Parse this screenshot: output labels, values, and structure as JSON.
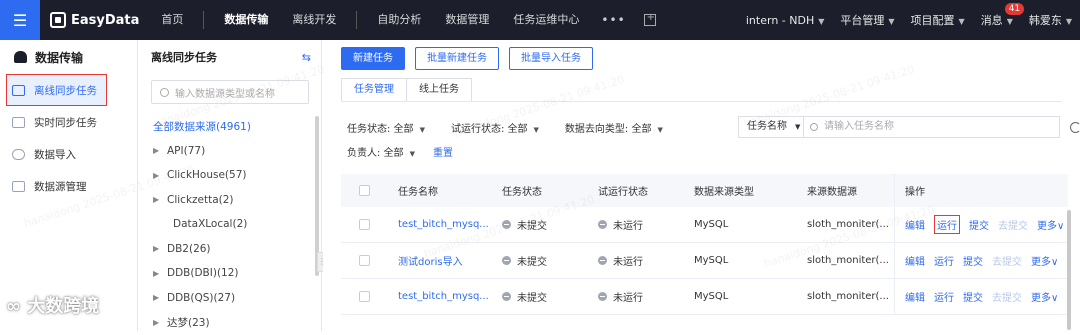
{
  "topbar": {
    "logo_text": "EasyData",
    "nav": [
      "首页",
      "数据传输",
      "离线开发",
      "自助分析",
      "数据管理",
      "任务运维中心"
    ],
    "more": "•••",
    "workspace": "intern - NDH",
    "platform": "平台管理",
    "project": "项目配置",
    "messages": "消息",
    "message_count": "41",
    "user": "韩爱东"
  },
  "sidebar": {
    "title": "数据传输",
    "items": [
      {
        "label": "离线同步任务",
        "active": true
      },
      {
        "label": "实时同步任务"
      },
      {
        "label": "数据导入"
      },
      {
        "label": "数据源管理"
      }
    ]
  },
  "tree": {
    "title": "离线同步任务",
    "collapse_icon": "⇆",
    "search_placeholder": "输入数据源类型或名称",
    "root": "全部数据来源(4961)",
    "items": [
      {
        "label": "API(77)",
        "arrow": true
      },
      {
        "label": "ClickHouse(57)",
        "arrow": true
      },
      {
        "label": "Clickzetta(2)",
        "arrow": true
      },
      {
        "label": "DataXLocal(2)",
        "arrow": false
      },
      {
        "label": "DB2(26)",
        "arrow": true
      },
      {
        "label": "DDB(DBI)(12)",
        "arrow": true
      },
      {
        "label": "DDB(QS)(27)",
        "arrow": true
      },
      {
        "label": "达梦(23)",
        "arrow": true
      }
    ]
  },
  "toolbar": {
    "new_task": "新建任务",
    "batch_new": "批量新建任务",
    "batch_import": "批量导入任务"
  },
  "tabs": [
    "任务管理",
    "线上任务"
  ],
  "filters": {
    "status": "任务状态: 全部",
    "trial": "试运行状态: 全部",
    "dest": "数据去向类型: 全部",
    "owner": "负责人: 全部",
    "reset": "重置",
    "search_field": "任务名称",
    "search_placeholder": "请输入任务名称"
  },
  "table": {
    "headers": [
      "任务名称",
      "任务状态",
      "试运行状态",
      "数据来源类型",
      "来源数据源",
      "操作"
    ],
    "rows": [
      {
        "name": "test_bitch_mysq...",
        "status": "未提交",
        "trial": "未运行",
        "type": "MySQL",
        "source": "sloth_moniter(...",
        "run_highlight": true
      },
      {
        "name": "测试doris导入",
        "status": "未提交",
        "trial": "未运行",
        "type": "MySQL",
        "source": "sloth_moniter(...",
        "run_highlight": false
      },
      {
        "name": "test_bitch_mysq...",
        "status": "未提交",
        "trial": "未运行",
        "type": "MySQL",
        "source": "sloth_moniter(...",
        "run_highlight": false
      }
    ],
    "ops": {
      "edit": "编辑",
      "run": "运行",
      "submit": "提交",
      "withdraw": "去提交",
      "more": "更多"
    }
  },
  "watermark": "hanaidong 2025-08-21 09:41:20",
  "corner_mark": "大数跨境"
}
